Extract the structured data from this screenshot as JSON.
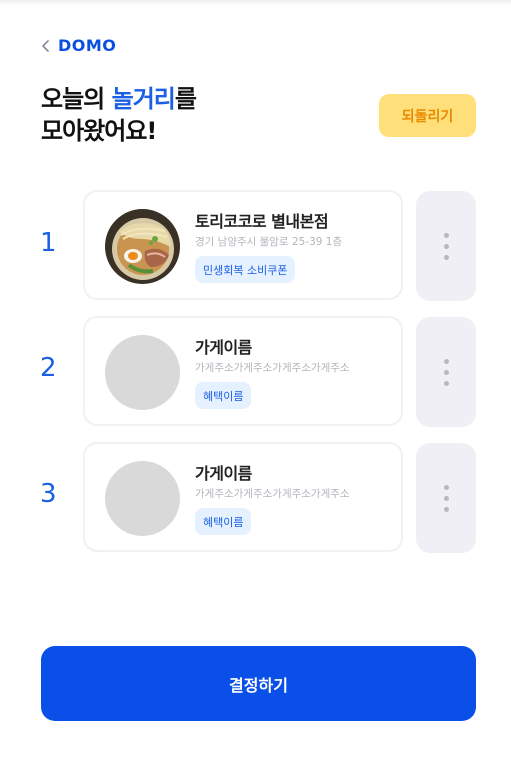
{
  "header": {
    "brand": "DOMO",
    "title_line1_prefix": "오늘의 ",
    "title_line1_accent": "놀거리",
    "title_line1_suffix": "를",
    "title_line2": "모아왔어요!",
    "undo_label": "되돌리기"
  },
  "list": [
    {
      "rank": "1",
      "name": "토리코코로 별내본점",
      "address": "경기 남양주시 불암로 25-39 1층",
      "tag": "민생회복 소비쿠폰",
      "has_photo": true
    },
    {
      "rank": "2",
      "name": "가게이름",
      "address": "가게주소가게주소가게주소가게주소",
      "tag": "혜택이름",
      "has_photo": false
    },
    {
      "rank": "3",
      "name": "가게이름",
      "address": "가게주소가게주소가게주소가게주소",
      "tag": "혜택이름",
      "has_photo": false
    }
  ],
  "footer": {
    "confirm_label": "결정하기"
  },
  "colors": {
    "primary": "#0a4fe8",
    "accent_text": "#1a5fe6",
    "undo_bg": "#ffdf7a",
    "undo_text": "#e98a00",
    "tag_bg": "#e5f1ff",
    "more_bg": "#efeff5"
  }
}
